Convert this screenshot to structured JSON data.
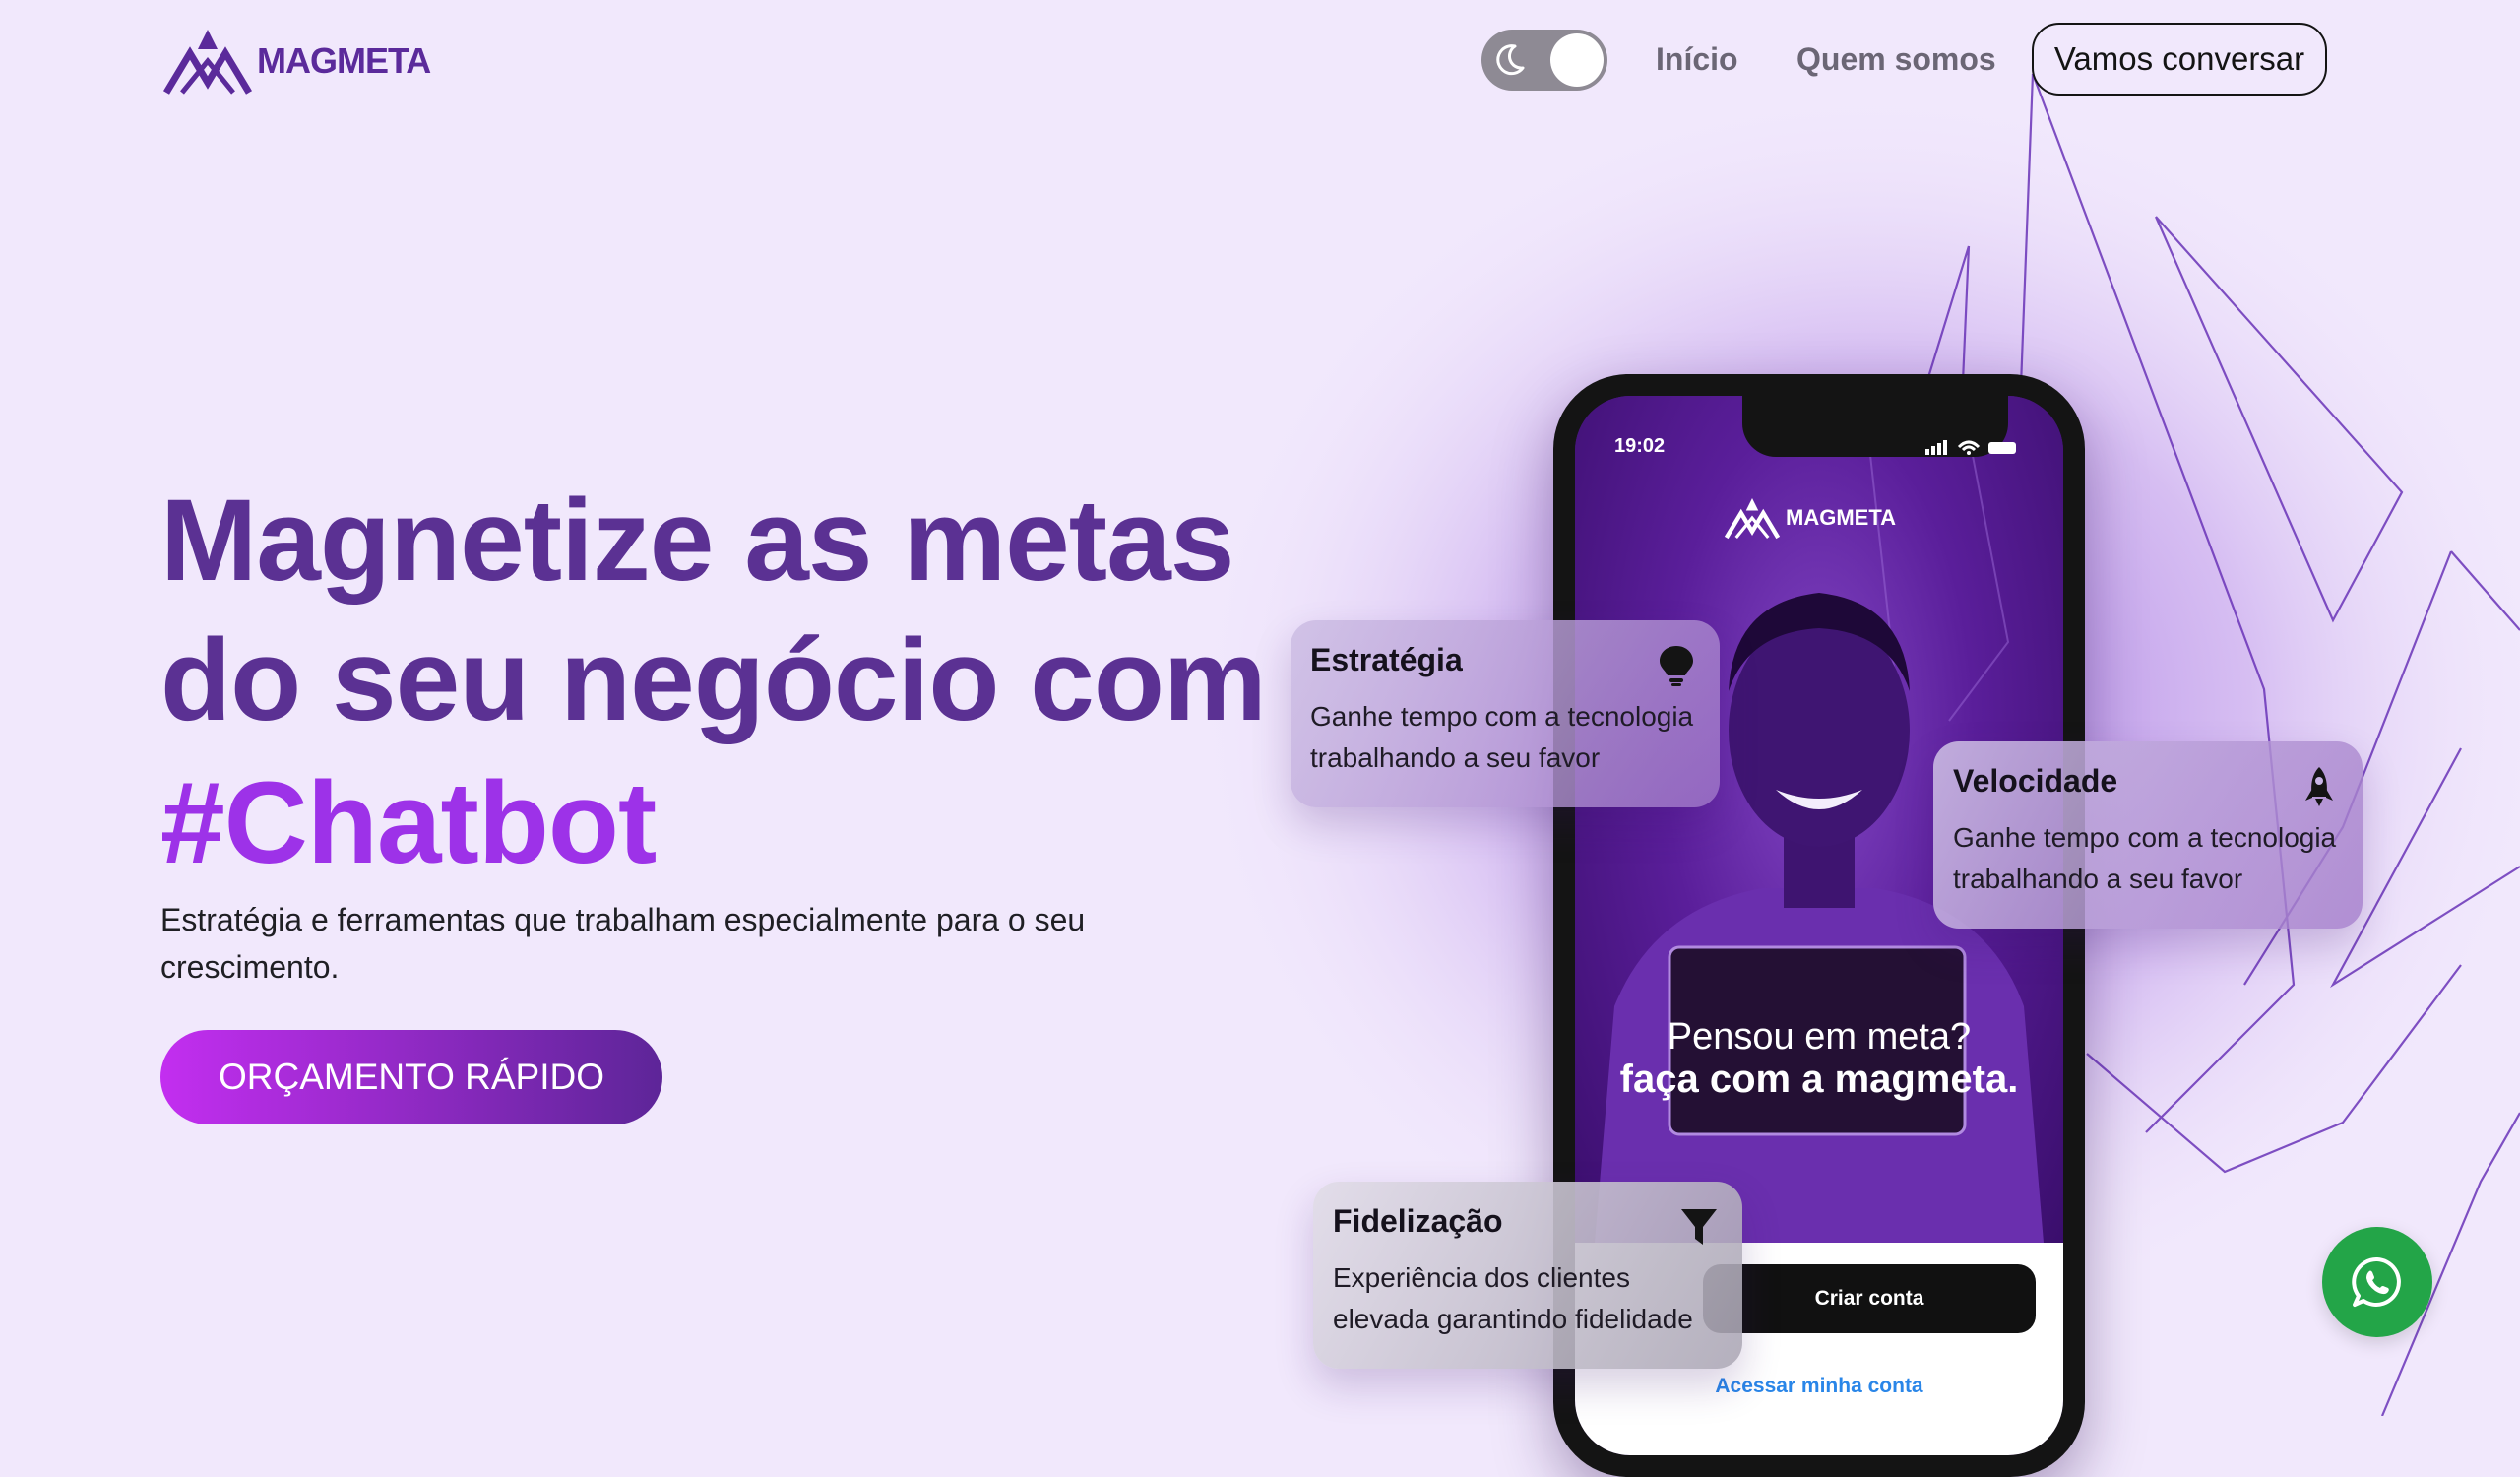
{
  "brand": {
    "name": "MAGMETA"
  },
  "nav": {
    "items": [
      {
        "label": "Início"
      },
      {
        "label": "Quem somos"
      }
    ],
    "cta_label": "Vamos conversar",
    "theme_toggle_icon": "moon-icon"
  },
  "hero": {
    "title": "Magnetize as metas do seu negócio com",
    "hashtag": "#Chatbot",
    "subtitle": "Estratégia e ferramentas que trabalham especialmente para o seu crescimento.",
    "button_label": "ORÇAMENTO RÁPIDO"
  },
  "phone": {
    "time": "19:02",
    "brand": "MAGMETA",
    "slogan_line1": "Pensou em meta?",
    "slogan_line2": "faça com a magmeta.",
    "create_account": "Criar conta",
    "access_account": "Acessar minha conta"
  },
  "features": [
    {
      "title": "Estratégia",
      "description": "Ganhe tempo com a tecnologia trabalhando a seu favor",
      "icon": "lightbulb-icon"
    },
    {
      "title": "Velocidade",
      "description": "Ganhe tempo com a tecnologia trabalhando a seu favor",
      "icon": "rocket-icon"
    },
    {
      "title": "Fidelização",
      "description": "Experiência dos clientes elevada garantindo fidelidade",
      "icon": "filter-icon"
    }
  ],
  "colors": {
    "background": "#f1e8fc",
    "heading": "#5b3193",
    "hashtag": "#9d32e8",
    "button_gradient_start": "#c32ef0",
    "button_gradient_end": "#5d2598",
    "whatsapp": "#23a548"
  },
  "floating_button_icon": "whatsapp-icon"
}
